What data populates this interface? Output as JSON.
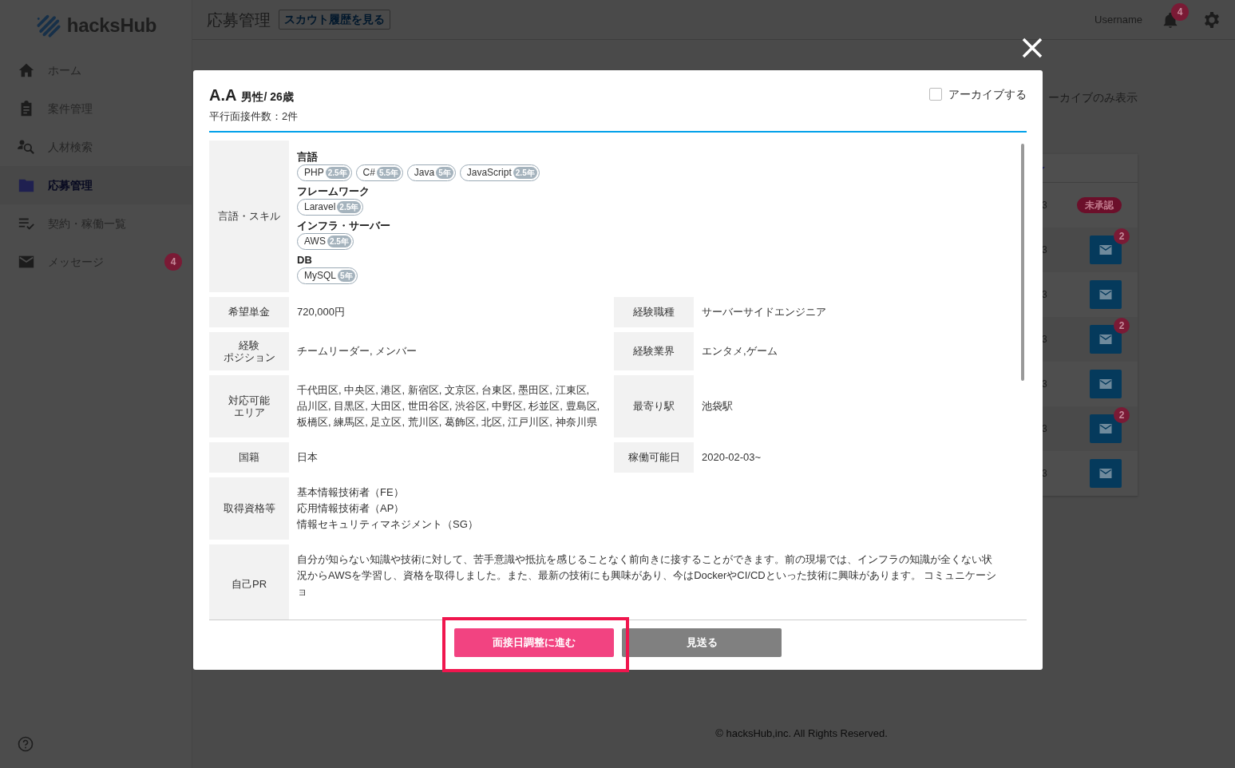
{
  "sidebar": {
    "logo": "hacksHub",
    "items": [
      {
        "label": "ホーム",
        "selected": false
      },
      {
        "label": "案件管理",
        "selected": false
      },
      {
        "label": "人材検索",
        "selected": false
      },
      {
        "label": "応募管理",
        "selected": true
      },
      {
        "label": "契約・稼働一覧",
        "selected": false
      },
      {
        "label": "メッセージ",
        "selected": false,
        "badge": "4"
      }
    ]
  },
  "header": {
    "title": "応募管理",
    "scout_button": "スカウト履歴を見る",
    "username": "Username",
    "notification_count": "4"
  },
  "archive_filter_label": "ーカイブのみ表示",
  "applicants_table": {
    "rows": [
      {
        "date": "3",
        "kind": "badge",
        "badge": "未承認"
      },
      {
        "date": "3",
        "kind": "message",
        "count": "2"
      },
      {
        "date": "3",
        "kind": "message"
      },
      {
        "date": "3",
        "kind": "message",
        "count": "2"
      },
      {
        "date": "3",
        "kind": "message"
      },
      {
        "date": "3",
        "kind": "message",
        "count": "2"
      },
      {
        "date": "3",
        "kind": "message"
      }
    ]
  },
  "modal": {
    "name": "A.A",
    "gender_age": "男性/ 26歳",
    "parallel_interviews": "平行面接件数：2件",
    "archive_checkbox": {
      "label": "アーカイブする",
      "checked": false
    },
    "skills_label": "言語・スキル",
    "skill_groups": [
      {
        "category": "言語",
        "skills": [
          {
            "name": "PHP",
            "years": "2.5年"
          },
          {
            "name": "C#",
            "years": "5.5年"
          },
          {
            "name": "Java",
            "years": "5年"
          },
          {
            "name": "JavaScript",
            "years": "2.5年"
          }
        ]
      },
      {
        "category": "フレームワーク",
        "skills": [
          {
            "name": "Laravel",
            "years": "2.5年"
          }
        ]
      },
      {
        "category": "インフラ・サーバー",
        "skills": [
          {
            "name": "AWS",
            "years": "2.5年"
          }
        ]
      },
      {
        "category": "DB",
        "skills": [
          {
            "name": "MySQL",
            "years": "5年"
          }
        ]
      }
    ],
    "field_rows": [
      {
        "cells": [
          {
            "label": [
              "希望単金"
            ],
            "value": [
              "720,000円"
            ]
          },
          {
            "label": [
              "経験職種"
            ],
            "value": [
              "サーバーサイドエンジニア"
            ]
          }
        ]
      },
      {
        "cells": [
          {
            "label": [
              "経験",
              "ポジション"
            ],
            "value": [
              "チームリーダー, メンバー"
            ]
          },
          {
            "label": [
              "経験業界"
            ],
            "value": [
              "エンタメ,ゲーム"
            ]
          }
        ]
      },
      {
        "cells": [
          {
            "label": [
              "対応可能",
              "エリア"
            ],
            "value": [
              "千代田区, 中央区, 港区, 新宿区, 文京区, 台東区, 墨田区, 江東区, 品川区, 目黒区, 大田区, 世田谷区, 渋谷区, 中野区, 杉並区, 豊島区, 板橋区, 練馬区, 足立区, 荒川区, 葛飾区, 北区, 江戸川区, 神奈川県"
            ]
          },
          {
            "label": [
              "最寄り駅"
            ],
            "value": [
              "池袋駅"
            ]
          }
        ]
      },
      {
        "cells": [
          {
            "label": [
              "国籍"
            ],
            "value": [
              "日本"
            ]
          },
          {
            "label": [
              "稼働可能日"
            ],
            "value": [
              "2020-02-03~"
            ]
          }
        ]
      },
      {
        "cells": [
          {
            "label": [
              "取得資格等"
            ],
            "value": [
              "基本情報技術者（FE）",
              "応用情報技術者（AP）",
              "情報セキュリティマネジメント（SG）"
            ]
          }
        ]
      }
    ],
    "self_pr": {
      "label": "自己PR",
      "text": "自分が知らない知識や技術に対して、苦手意識や抵抗を感じることなく前向きに接することができます。前の現場では、インフラの知識が全くない状況からAWSを学習し、資格を取得しました。また、最新の技術にも興味があり、今はDockerやCI/CDといった技術に興味があります。 コミュニケーショ"
    },
    "buttons": [
      {
        "label": "面接日調整に進む",
        "kind": "primary",
        "highlighted": true
      },
      {
        "label": "見送る",
        "kind": "secondary",
        "highlighted": false
      }
    ]
  },
  "footer": "© hacksHub,inc. All Rights Reserved."
}
